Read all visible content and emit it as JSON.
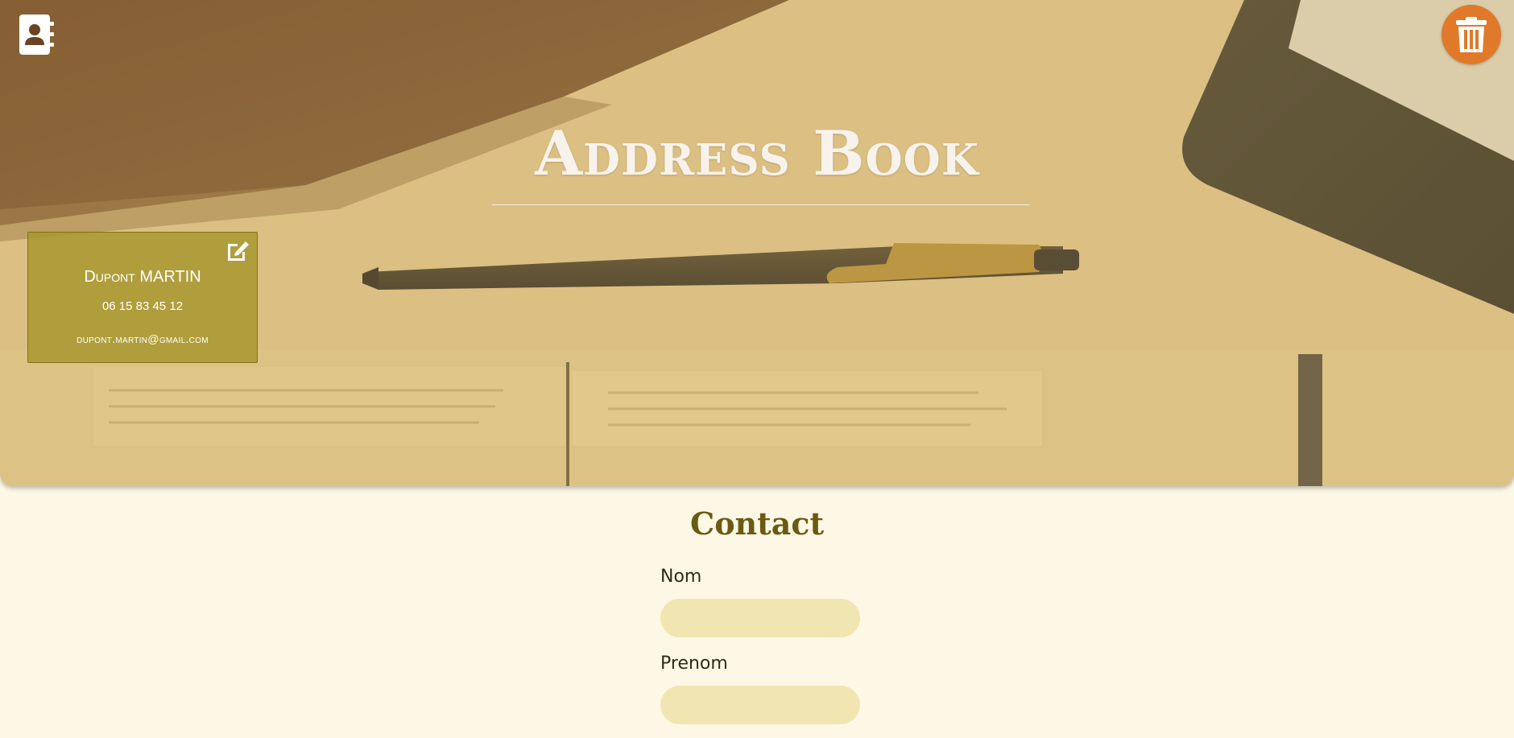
{
  "header": {
    "title": "Address Book",
    "contacts_icon": "address-book-icon",
    "trash_icon": "trash-icon"
  },
  "contact_card": {
    "name": "Dupont MARTIN",
    "phone": "06 15 83 45 12",
    "email": "dupont.martin@gmail.com",
    "edit_icon": "edit-icon"
  },
  "form": {
    "title": "Contact",
    "fields": [
      {
        "label": "Nom",
        "value": "",
        "placeholder": ""
      },
      {
        "label": "Prenom",
        "value": "",
        "placeholder": ""
      }
    ]
  },
  "colors": {
    "background": "#fdf8e6",
    "accent": "#e07a2a",
    "card": "#a6962c",
    "input": "#f1e6b1",
    "heading": "#6b5a12"
  }
}
